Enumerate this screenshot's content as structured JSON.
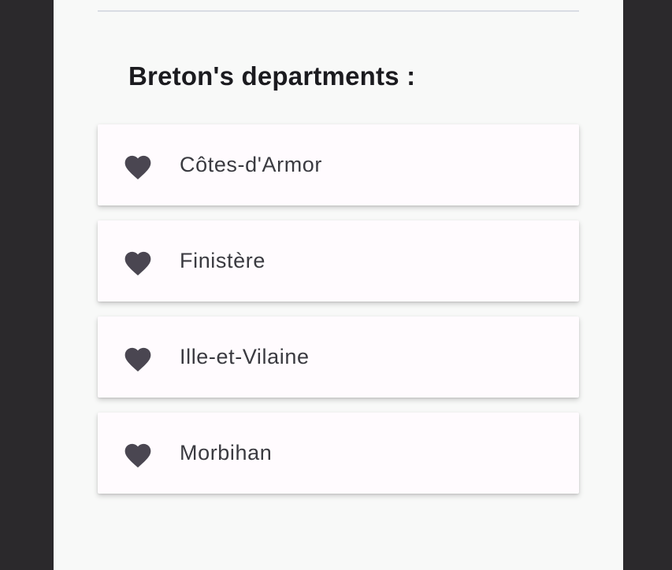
{
  "section": {
    "title": "Breton's departments :"
  },
  "departments": [
    {
      "label": "Côtes-d'Armor",
      "icon": "heart-icon"
    },
    {
      "label": "Finistère",
      "icon": "heart-icon"
    },
    {
      "label": "Ille-et-Vilaine",
      "icon": "heart-icon"
    },
    {
      "label": "Morbihan",
      "icon": "heart-icon"
    }
  ],
  "colors": {
    "outer_background": "#2b292c",
    "screen_background": "#f8f9f8",
    "card_background": "#fffbfe",
    "heart_icon": "#4a4651",
    "title_text": "#1b1b1f",
    "divider": "#d9dce3"
  }
}
